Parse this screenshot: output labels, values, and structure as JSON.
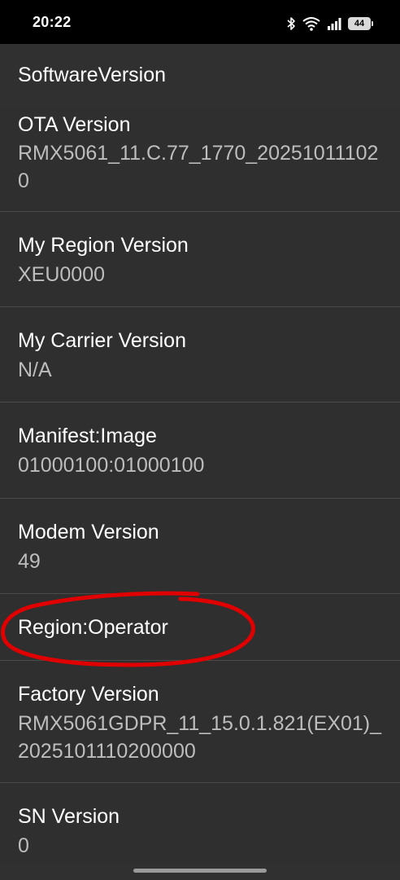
{
  "status_bar": {
    "time": "20:22",
    "battery_level": "44",
    "icons": [
      "bluetooth-icon",
      "wifi-icon",
      "signal-icon",
      "battery-icon"
    ]
  },
  "app_bar": {
    "title": "SoftwareVersion"
  },
  "items": [
    {
      "title": "OTA Version",
      "value": "RMX5061_11.C.77_1770_202510111020"
    },
    {
      "title": "My Region Version",
      "value": "XEU0000"
    },
    {
      "title": "My Carrier Version",
      "value": "N/A"
    },
    {
      "title": "Manifest:Image",
      "value": "01000100:01000100"
    },
    {
      "title": "Modem Version",
      "value": "49"
    },
    {
      "title": "Region:Operator",
      "value": ""
    },
    {
      "title": "Factory Version",
      "value": "RMX5061GDPR_11_15.0.1.821(EX01)_2025101110200000"
    },
    {
      "title": "SN Version",
      "value": "0"
    }
  ],
  "colors": {
    "background": "#303030",
    "status_bar": "#000000",
    "title_text": "#ffffff",
    "value_text": "#bdbdbd",
    "annotation": "#e00000"
  }
}
